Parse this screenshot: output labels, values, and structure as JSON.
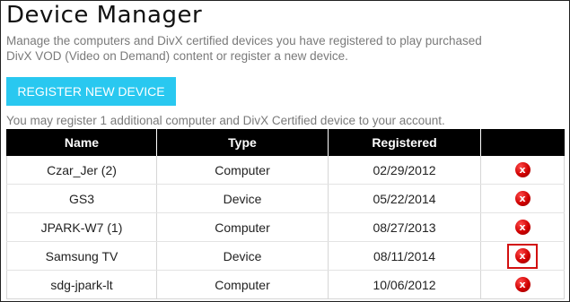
{
  "page": {
    "title": "Device Manager",
    "description": "Manage the computers and DivX certified devices you have registered to play purchased DivX VOD (Video on Demand) content or register a new device.",
    "register_button": "REGISTER NEW DEVICE",
    "notice": "You may register 1 additional computer and DivX Certified device to your account."
  },
  "table": {
    "headers": [
      "Name",
      "Type",
      "Registered",
      ""
    ],
    "rows": [
      {
        "name": "Czar_Jer (2)",
        "type": "Computer",
        "registered": "02/29/2012",
        "highlighted": false
      },
      {
        "name": "GS3",
        "type": "Device",
        "registered": "05/22/2014",
        "highlighted": false
      },
      {
        "name": "JPARK-W7 (1)",
        "type": "Computer",
        "registered": "08/27/2013",
        "highlighted": false
      },
      {
        "name": "Samsung TV",
        "type": "Device",
        "registered": "08/11/2014",
        "highlighted": true
      },
      {
        "name": "sdg-jpark-lt",
        "type": "Computer",
        "registered": "10/06/2012",
        "highlighted": false
      }
    ],
    "delete_glyph": "x"
  },
  "icons": {
    "delete": "delete-x-circle-icon"
  },
  "colors": {
    "accent": "#29c8f0",
    "header_bg": "#000000",
    "delete_red": "#d00000",
    "highlight_border": "#d21010",
    "muted_text": "#7a7a7a"
  }
}
